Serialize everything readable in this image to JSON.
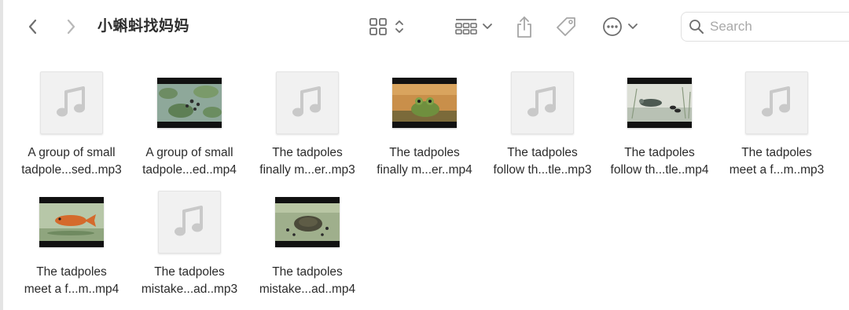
{
  "window": {
    "title": "小蝌蚪找妈妈"
  },
  "toolbar": {
    "back_icon": "chevron-left-icon",
    "forward_icon": "chevron-right-icon",
    "view_icon": "icon-grid-view-icon",
    "group_icon": "group-by-icon",
    "share_icon": "share-icon",
    "tag_icon": "tag-icon",
    "more_icon": "ellipsis-circle-icon"
  },
  "search": {
    "placeholder": "Search"
  },
  "files": [
    {
      "line1": "A group of small",
      "line2": "tadpole...sed..mp3",
      "kind": "audio"
    },
    {
      "line1": "A group of small",
      "line2": "tadpole...ed..mp4",
      "kind": "video",
      "scene": "pond-leaves"
    },
    {
      "line1": "The tadpoles",
      "line2": "finally m...er..mp3",
      "kind": "audio"
    },
    {
      "line1": "The tadpoles",
      "line2": "finally m...er..mp4",
      "kind": "video",
      "scene": "frog-sunset"
    },
    {
      "line1": "The tadpoles",
      "line2": "follow th...tle..mp3",
      "kind": "audio"
    },
    {
      "line1": "The tadpoles",
      "line2": "follow th...tle..mp4",
      "kind": "video",
      "scene": "turtle-reeds"
    },
    {
      "line1": "The tadpoles",
      "line2": "meet a f...m..mp3",
      "kind": "audio"
    },
    {
      "line1": "The tadpoles",
      "line2": "meet a f...m..mp4",
      "kind": "video",
      "scene": "goldfish"
    },
    {
      "line1": "The tadpoles",
      "line2": "mistake...ad..mp3",
      "kind": "audio"
    },
    {
      "line1": "The tadpoles",
      "line2": "mistake...ad..mp4",
      "kind": "video",
      "scene": "crab-pond"
    }
  ],
  "colors": {
    "accent_icon": "#6e6e6e",
    "audio_note": "#c9c9c9",
    "audio_tile": "#f1f1f1"
  }
}
